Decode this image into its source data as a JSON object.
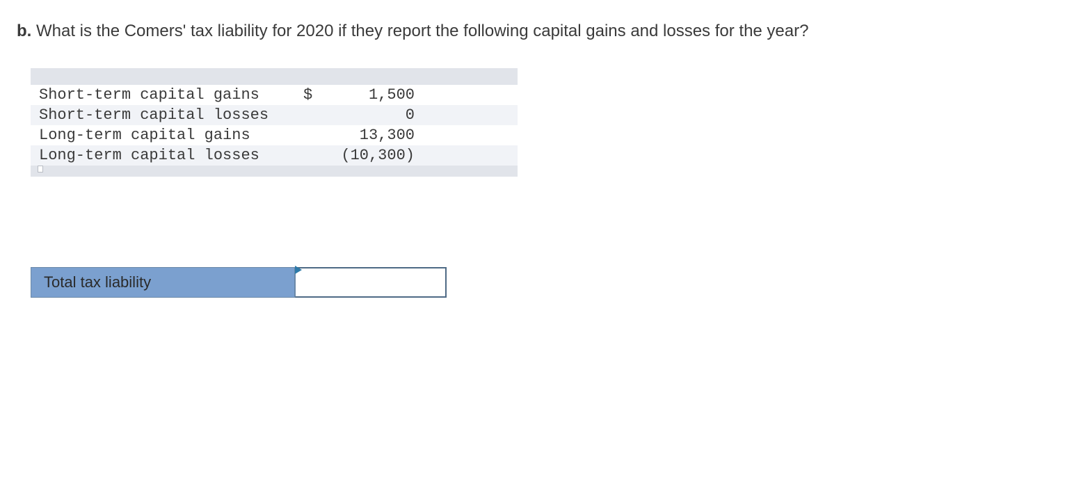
{
  "question": {
    "label": "b.",
    "text": "What is the Comers' tax liability for 2020 if they report the following capital gains and losses for the year?"
  },
  "table": {
    "rows": [
      {
        "label": "Short-term capital gains",
        "currency": "$",
        "value": "1,500"
      },
      {
        "label": "Short-term capital losses",
        "currency": "",
        "value": "0"
      },
      {
        "label": "Long-term capital gains",
        "currency": "",
        "value": "13,300"
      },
      {
        "label": "Long-term capital losses",
        "currency": "",
        "value": "(10,300)"
      }
    ]
  },
  "answer": {
    "label": "Total tax liability",
    "value": ""
  }
}
